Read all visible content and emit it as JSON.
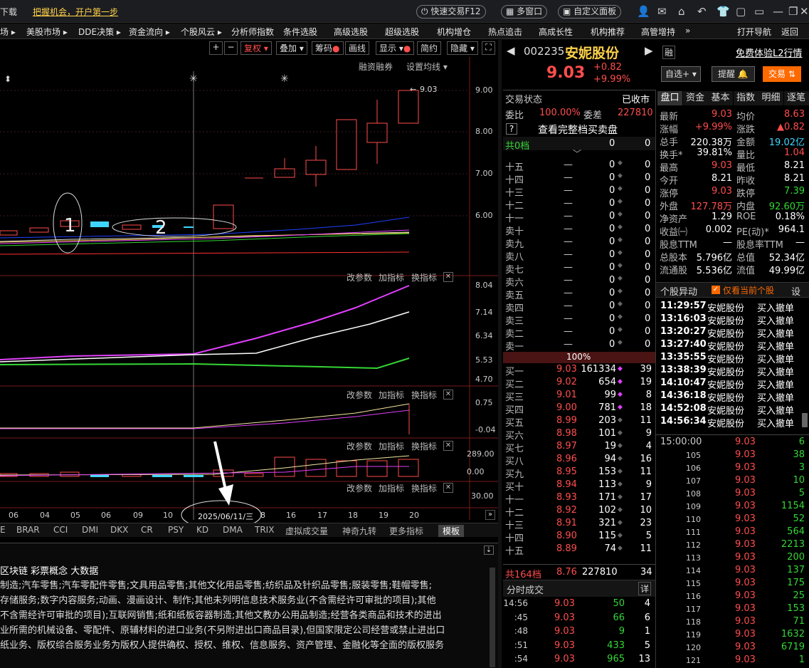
{
  "header": {
    "left_truncated": "下载",
    "promo": "把握机会，开户第一步",
    "quick_trade": "快速交易F12",
    "multi_window": "多窗口",
    "custom_panel": "自定义面板"
  },
  "menu": [
    "场 ▸",
    "美股市场 ▸",
    "DDE决策 ▸",
    "资金流向 ▸",
    "个股风云 ▸",
    "分析师指数",
    "条件选股",
    "高级选股",
    "超级选股",
    "机构增仓",
    "热点追击",
    "高成长性",
    "机构推荐",
    "高管增持",
    "»",
    "打开导航",
    "返回"
  ],
  "toolbar": {
    "plus": "+",
    "minus": "−",
    "fuquan": "复权",
    "diejia": "叠加",
    "chouma": "筹码",
    "huaxian": "画线",
    "xianshi": "显示",
    "jianyue": "简约",
    "yincang": "隐藏"
  },
  "chart_ctrl": {
    "rongzi": "融资融券",
    "avg_setting": "设置均线"
  },
  "kline_axis": [
    "9.00",
    "8.00",
    "7.00",
    "6.00"
  ],
  "price_label": "9.03",
  "ann": {
    "one": "1",
    "two": "2"
  },
  "sub1": {
    "btns": [
      "改参数",
      "加指标",
      "换指标"
    ],
    "axis": [
      "8.04",
      "7.14",
      "6.34",
      "5.53",
      "4.70"
    ]
  },
  "sub2": {
    "axis": [
      "0.75",
      "-0.04"
    ]
  },
  "sub3": {
    "axis": [
      "289.00",
      "0.00"
    ]
  },
  "sub4": {
    "axis": [
      "30.00"
    ]
  },
  "date_axis": [
    "06",
    "04",
    "05",
    "06",
    "09",
    "10",
    "",
    "",
    "16",
    "17",
    "18",
    "19",
    "20"
  ],
  "cursor_date": "2025/06/11/三",
  "cursor_date_suffix": "8",
  "ind_tabs": [
    "E",
    "BRAR",
    "CCI",
    "DMI",
    "DKX",
    "CR",
    "PSY",
    "KD",
    "DMA",
    "TRIX",
    "虚拟成交量",
    "神奇九转",
    "更多指标",
    "模板"
  ],
  "info": {
    "title": "区块链  彩票概念  大数据",
    "lines": [
      "制造;汽车零售;汽车零配件零售;文具用品零售;其他文化用品零售;纺织品及针织品零售;服装零售;鞋帽零售;",
      "存储服务;数字内容服务;动画、漫画设计、制作;其他未列明信息技术服务业(不含需经许可审批的项目);其他",
      "不含需经许可审批的项目);互联网销售;纸和纸板容器制造;其他文教办公用品制造;经营各类商品和技术的进出",
      "业所需的机械设备、零配件、原辅材料的进口业务(不另附进出口商品目录),但国家限定公司经营或禁止进出口",
      "纸业务、版权综合服务业务为版权人提供确权、授权、维权、信息服务、资产管理、金融化等全面的版权服务"
    ]
  },
  "stock": {
    "code": "002235",
    "name": "安妮股份",
    "rong": "融",
    "l2": "免费体验L2行情",
    "price": "9.03",
    "change": "+0.82",
    "pct": "+9.99%",
    "zixuan": "自选+",
    "tixing": "提醒",
    "jiaoyi": "交易"
  },
  "status": {
    "label": "交易状态",
    "value": "已收市",
    "weibi_l": "委比",
    "weibi": "100.00%",
    "weicha_l": "委差",
    "weicha": "227810",
    "full": "查看完整档买卖盘",
    "q": "?"
  },
  "sell_total": {
    "label": "共0档",
    "v1": "0",
    "v2": "0"
  },
  "sells": [
    [
      "十五",
      "—",
      "0",
      "0"
    ],
    [
      "十四",
      "—",
      "0",
      "0"
    ],
    [
      "十三",
      "—",
      "0",
      "0"
    ],
    [
      "十二",
      "—",
      "0",
      "0"
    ],
    [
      "十一",
      "—",
      "0",
      "0"
    ],
    [
      "卖十",
      "—",
      "0",
      "0"
    ],
    [
      "卖九",
      "—",
      "0",
      "0"
    ],
    [
      "卖八",
      "—",
      "0",
      "0"
    ],
    [
      "卖七",
      "—",
      "0",
      "0"
    ],
    [
      "卖六",
      "—",
      "0",
      "0"
    ],
    [
      "卖五",
      "—",
      "0",
      "0"
    ],
    [
      "卖四",
      "—",
      "0",
      "0"
    ],
    [
      "卖三",
      "—",
      "0",
      "0"
    ],
    [
      "卖二",
      "—",
      "0",
      "0"
    ],
    [
      "卖一",
      "—",
      "0",
      "0"
    ]
  ],
  "ratio": "100%",
  "buys": [
    [
      "买一",
      "9.03",
      "161334",
      "39"
    ],
    [
      "买二",
      "9.02",
      "654",
      "19"
    ],
    [
      "买三",
      "9.01",
      "99",
      "8"
    ],
    [
      "买四",
      "9.00",
      "781",
      "18"
    ],
    [
      "买五",
      "8.99",
      "203",
      "11"
    ],
    [
      "买六",
      "8.98",
      "101",
      "9"
    ],
    [
      "买七",
      "8.97",
      "19",
      "4"
    ],
    [
      "买八",
      "8.96",
      "94",
      "16"
    ],
    [
      "买九",
      "8.95",
      "153",
      "11"
    ],
    [
      "买十",
      "8.94",
      "113",
      "9"
    ],
    [
      "十一",
      "8.93",
      "171",
      "17"
    ],
    [
      "十二",
      "8.92",
      "102",
      "10"
    ],
    [
      "十三",
      "8.91",
      "321",
      "23"
    ],
    [
      "十四",
      "8.90",
      "115",
      "5"
    ],
    [
      "十五",
      "8.89",
      "74",
      "11"
    ]
  ],
  "buy_total": {
    "label": "共164档",
    "p": "8.76",
    "v": "227810",
    "n": "34"
  },
  "ticks_title": "分时成交",
  "xiang": "详",
  "ticks": [
    [
      "14:56",
      "9.03",
      "50",
      "4"
    ],
    [
      ":45",
      "9.03",
      "66",
      "6"
    ],
    [
      ":48",
      "9.03",
      "9",
      "1"
    ],
    [
      ":51",
      "9.03",
      "433",
      "5"
    ],
    [
      ":54",
      "9.03",
      "965",
      "13"
    ]
  ],
  "rtabs": [
    "盘口",
    "资金",
    "基本",
    "指数",
    "明细",
    "逐笔"
  ],
  "quote": [
    [
      "最新",
      "9.03",
      "均价",
      "8.63"
    ],
    [
      "涨幅",
      "+9.99%",
      "涨跌",
      "▲0.82"
    ],
    [
      "总手",
      "220.38万",
      "金额",
      "19.02亿"
    ],
    [
      "换手*",
      "39.81%",
      "量比",
      "1.04"
    ],
    [
      "最高",
      "9.03",
      "最低",
      "8.21"
    ],
    [
      "今开",
      "8.21",
      "昨收",
      "8.21"
    ],
    [
      "涨停",
      "9.03",
      "跌停",
      "7.39"
    ],
    [
      "外盘",
      "127.78万",
      "内盘",
      "92.60万"
    ],
    [
      "净资产",
      "1.29",
      "ROE",
      "0.18%"
    ],
    [
      "收益㈠",
      "0.002",
      "PE(动)*",
      "964.1"
    ],
    [
      "股息TTM",
      "—",
      "股息率TTM",
      "—"
    ],
    [
      "总股本",
      "5.796亿",
      "总值",
      "52.34亿"
    ],
    [
      "流通股",
      "5.536亿",
      "流值",
      "49.99亿"
    ]
  ],
  "yidong": {
    "title": "个股异动",
    "only": "仅看当前个股",
    "set": "设",
    "rows": [
      [
        "11:29:57",
        "安妮股份",
        "买入撤单"
      ],
      [
        "13:16:03",
        "安妮股份",
        "买入撤单"
      ],
      [
        "13:20:27",
        "安妮股份",
        "买入撤单"
      ],
      [
        "13:27:40",
        "安妮股份",
        "买入撤单"
      ],
      [
        "13:35:55",
        "安妮股份",
        "买入撤单"
      ],
      [
        "13:38:39",
        "安妮股份",
        "买入撤单"
      ],
      [
        "14:10:47",
        "安妮股份",
        "买入撤单"
      ],
      [
        "14:36:18",
        "安妮股份",
        "买入撤单"
      ],
      [
        "14:52:08",
        "安妮股份",
        "买入撤单"
      ],
      [
        "14:56:34",
        "安妮股份",
        "买入撤单"
      ]
    ]
  },
  "mins": [
    [
      "15:00:00",
      "9.03",
      "6"
    ],
    [
      "105",
      "9.03",
      "38"
    ],
    [
      "106",
      "9.03",
      "3"
    ],
    [
      "107",
      "9.03",
      "10"
    ],
    [
      "108",
      "9.03",
      "5"
    ],
    [
      "109",
      "9.03",
      "1154"
    ],
    [
      "110",
      "9.03",
      "52"
    ],
    [
      "111",
      "9.03",
      "564"
    ],
    [
      "112",
      "9.03",
      "2213"
    ],
    [
      "113",
      "9.03",
      "200"
    ],
    [
      "114",
      "9.03",
      "137"
    ],
    [
      "115",
      "9.03",
      "175"
    ],
    [
      "116",
      "9.03",
      "25"
    ],
    [
      "117",
      "9.03",
      "153"
    ],
    [
      "118",
      "9.03",
      "71"
    ],
    [
      "119",
      "9.03",
      "1632"
    ],
    [
      "120",
      "9.03",
      "6719"
    ],
    [
      "121",
      "9.03",
      "1"
    ]
  ]
}
